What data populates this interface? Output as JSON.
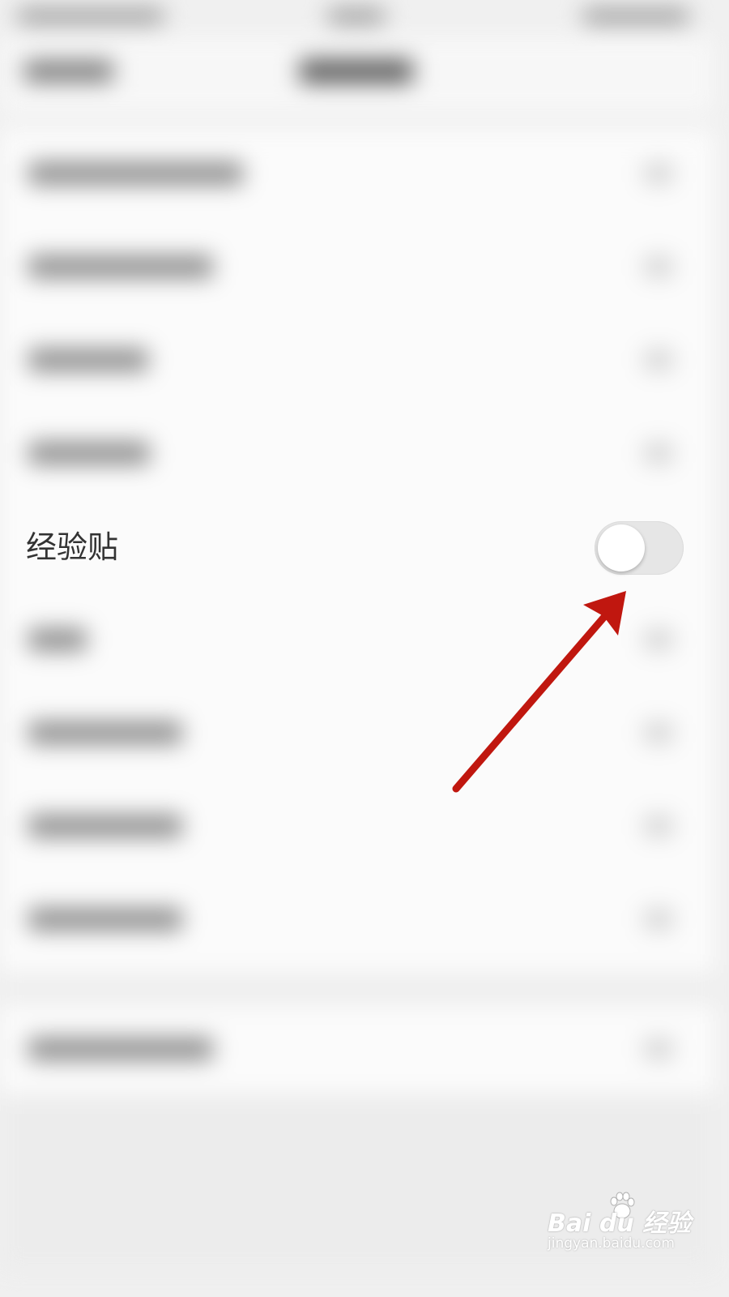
{
  "focused_row": {
    "label": "经验贴",
    "toggle_on": false
  },
  "watermark": {
    "logo_text": "Bai du 经验",
    "url": "jingyan.baidu.com"
  },
  "colors": {
    "arrow": "#c0170f",
    "toggle_track_off": "#e6e6e6",
    "toggle_knob": "#ffffff",
    "label_text": "#333333"
  }
}
